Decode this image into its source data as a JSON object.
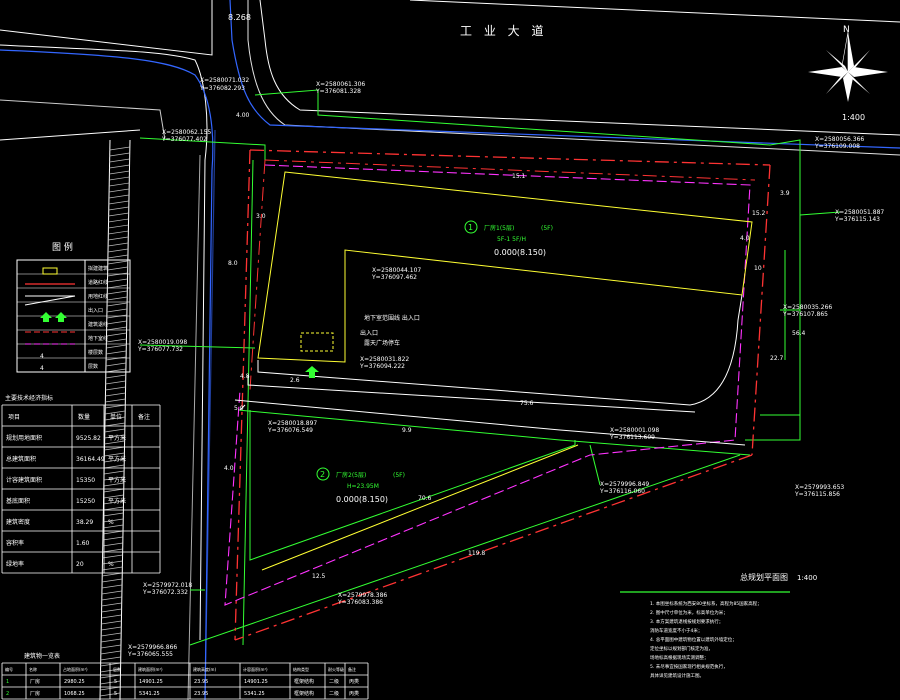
{
  "road": {
    "name": "工 业 大 道",
    "elevation": "8.268"
  },
  "north": {
    "label": "N"
  },
  "scale": "1:400",
  "coords": {
    "nw_road": [
      "X=2580071.032",
      "Y=376082.293"
    ],
    "top": [
      "X=2580061.306",
      "Y=376081.328"
    ],
    "west_top": [
      "X=2580062.155",
      "Y=376077.402"
    ],
    "ne": [
      "X=2580056.366",
      "Y=376109.008"
    ],
    "east": [
      "X=2580051.887",
      "Y=376115.143"
    ],
    "inner_top": [
      "X=2580044.107",
      "Y=376097.462"
    ],
    "east_mid": [
      "X=2580035.266",
      "Y=376107.865"
    ],
    "west_mid": [
      "X=2580019.098",
      "Y=376077.732"
    ],
    "inner_mid": [
      "X=2580031.822",
      "Y=376094.222"
    ],
    "mid_left": [
      "X=2580018.897",
      "Y=376076.549"
    ],
    "mid_right": [
      "X=2580001.098",
      "Y=376113.609"
    ],
    "se": [
      "X=2579993.653",
      "Y=376115.856"
    ],
    "center": [
      "X=2579996.849",
      "Y=376116.060"
    ],
    "sw": [
      "X=2579972.018",
      "Y=376072.332"
    ],
    "bottom_tip": [
      "X=2579978.386",
      "Y=376083.386"
    ],
    "bottom_left": [
      "X=2579966.866",
      "Y=376065.555"
    ]
  },
  "plant1": {
    "num": "1",
    "name": "厂房1(5层)",
    "floors": "(5F)",
    "sub": "5F-1 5F/H",
    "elev": "0.000(8.150)"
  },
  "plant2": {
    "num": "2",
    "name": "厂房2(5层)",
    "floors": "(5F)",
    "sub": "H=23.95M",
    "elev": "0.000(8.150)"
  },
  "notes": {
    "basement": "地下室范围线 出入口",
    "entry": "出入口",
    "parking": "露天广场停车"
  },
  "dims": [
    "4.00",
    "8.0",
    "4.8",
    "15.1",
    "4.0",
    "3.9",
    "2.6",
    "5.0",
    "22.7",
    "75.6",
    "9.9",
    "70.6",
    "12.5",
    "15.2",
    "56.4",
    "119.8",
    "10",
    "3.0",
    "4.0"
  ],
  "legend": {
    "title": "图  例",
    "items": [
      {
        "sym": "yellow-box",
        "label": "拟建建筑"
      },
      {
        "sym": "red-line",
        "label": "道路红线"
      },
      {
        "sym": "white-line",
        "label": "用地红线"
      },
      {
        "sym": "green-arrow",
        "label": "出入口"
      },
      {
        "sym": "red-dash",
        "label": "建筑退线"
      },
      {
        "sym": "magenta-dash",
        "label": "地下室线"
      },
      {
        "sym": "num",
        "label": "楼层数"
      },
      {
        "sym": "num",
        "label": "层数"
      }
    ],
    "nums": [
      "4",
      "4"
    ]
  },
  "econ": {
    "title": "主要技术经济指标",
    "headers": [
      "项目",
      "数量",
      "单位",
      "备注"
    ],
    "rows": [
      [
        "规划用地面积",
        "9525.82",
        "平方米",
        ""
      ],
      [
        "总建筑面积",
        "36164.49",
        "平方米",
        ""
      ],
      [
        "计容建筑面积",
        "15350",
        "平方米",
        ""
      ],
      [
        "基底面积",
        "15250",
        "平方米",
        ""
      ],
      [
        "建筑密度",
        "38.29",
        "%",
        ""
      ],
      [
        "容积率",
        "1.60",
        "",
        ""
      ],
      [
        "绿地率",
        "20",
        "%",
        ""
      ]
    ]
  },
  "building_table": {
    "title": "建筑物一览表",
    "headers": [
      "编号",
      "名称",
      "占地面积(m²)",
      "层数",
      "建筑面积(m²)",
      "建筑高度(m)",
      "计容面积(m²)",
      "结构类型",
      "耐火等级",
      "备注"
    ],
    "rows": [
      [
        "1",
        "厂房",
        "2980.25",
        "5",
        "14901.25",
        "23.95",
        "14901.25",
        "框架结构",
        "二级",
        "丙类"
      ],
      [
        "2",
        "厂房",
        "1068.25",
        "5",
        "5341.25",
        "23.95",
        "5341.25",
        "框架结构",
        "二级",
        "丙类"
      ]
    ]
  },
  "plan_title": "总规划平面图",
  "plan_scale": "1:400",
  "plan_notes": [
    "1. 本图坐标系统为西安80坐标系，高程为85国家高程；",
    "2. 图中尺寸单位为米，标高单位为米；",
    "3. 本方案建筑退线按规划要求执行；",
    "   消防车道宽度不小于4米；",
    "4. 总平面图中建筑物位置以建筑外墙定位；",
    "   定位坐标以规划部门核定为准，",
    "   场地标高根据现场实测调整；",
    "5. 未尽事宜按国家现行相关规范执行，",
    "   具体详见建筑设计施工图。"
  ]
}
